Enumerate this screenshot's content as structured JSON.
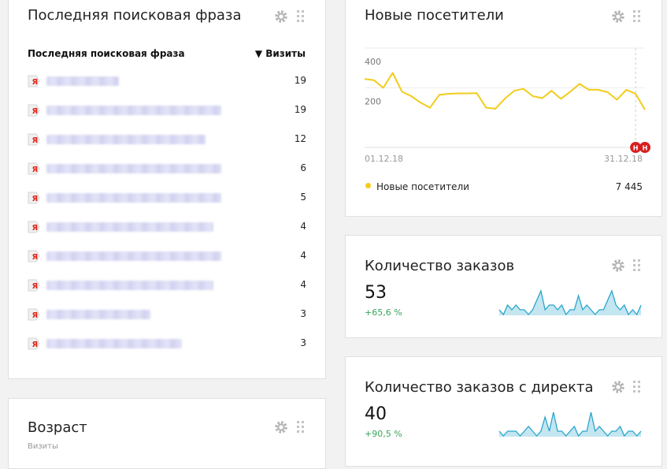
{
  "phrases_widget": {
    "title": "Последняя поисковая фраза",
    "col_phrase": "Последняя поисковая фраза",
    "col_visits": "▼ Визиты",
    "rows": [
      {
        "visits": "19"
      },
      {
        "visits": "19"
      },
      {
        "visits": "12"
      },
      {
        "visits": "6"
      },
      {
        "visits": "5"
      },
      {
        "visits": "4"
      },
      {
        "visits": "4"
      },
      {
        "visits": "4"
      },
      {
        "visits": "3"
      },
      {
        "visits": "3"
      }
    ]
  },
  "new_visitors_widget": {
    "title": "Новые посетители",
    "y_ticks": [
      "400",
      "200"
    ],
    "x_start": "01.12.18",
    "x_end": "31.12.18",
    "marker_label": "Н",
    "legend_label": "Новые посетители",
    "total": "7 445",
    "line_color": "#f2cc1a",
    "values": [
      345,
      338,
      300,
      375,
      280,
      258,
      225,
      200,
      265,
      270,
      272,
      272,
      273,
      200,
      195,
      245,
      285,
      295,
      258,
      248,
      285,
      245,
      280,
      320,
      290,
      290,
      278,
      240,
      290,
      270,
      190
    ]
  },
  "orders_widget": {
    "title": "Количество заказов",
    "value": "53",
    "delta": "+65,6 %",
    "spark_color": "#29a6cc",
    "spark": [
      1,
      0,
      2,
      1,
      2,
      1,
      1,
      0,
      1,
      3,
      5,
      1,
      2,
      2,
      1,
      2,
      0,
      1,
      1,
      4,
      1,
      2,
      1,
      0,
      1,
      1,
      3,
      5,
      2,
      1,
      2,
      0,
      1,
      0,
      2
    ]
  },
  "orders_direct_widget": {
    "title": "Количество заказов с директа",
    "value": "40",
    "delta": "+90,5 %",
    "spark_color": "#29a6cc",
    "spark": [
      1,
      0,
      1,
      1,
      1,
      0,
      1,
      2,
      1,
      0,
      1,
      4,
      1,
      5,
      1,
      1,
      0,
      1,
      2,
      0,
      1,
      1,
      5,
      1,
      2,
      1,
      0,
      1,
      1,
      2,
      0,
      1,
      1,
      0,
      1
    ]
  },
  "age_widget": {
    "title": "Возраст",
    "subtitle": "Визиты"
  }
}
